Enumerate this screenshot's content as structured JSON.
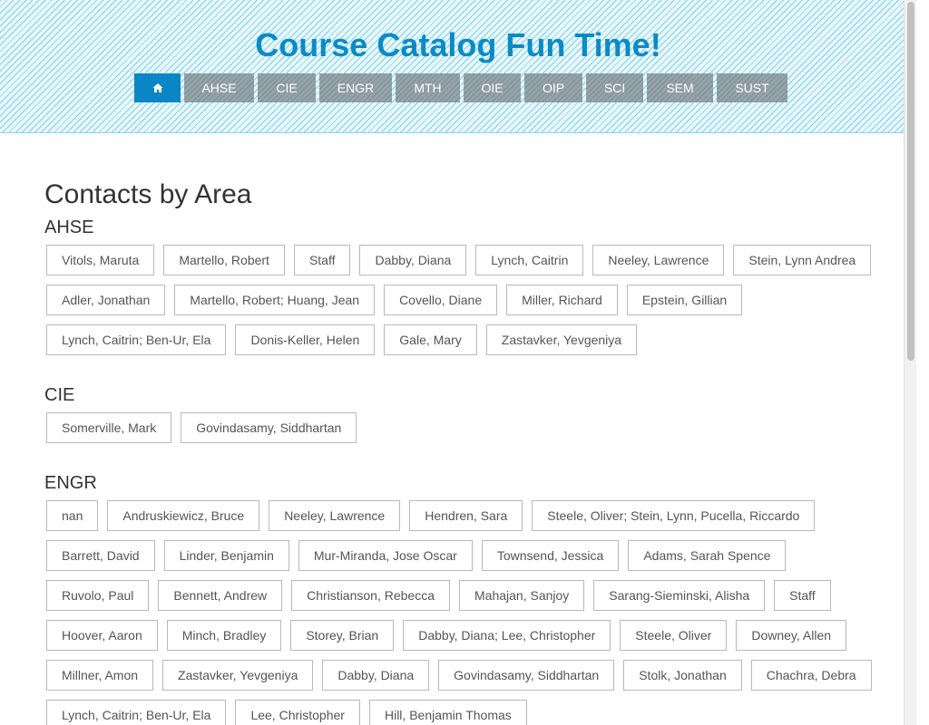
{
  "header": {
    "title": "Course Catalog Fun Time!",
    "nav": [
      {
        "label": "",
        "icon": "home-icon",
        "active": true
      },
      {
        "label": "AHSE"
      },
      {
        "label": "CIE"
      },
      {
        "label": "ENGR"
      },
      {
        "label": "MTH"
      },
      {
        "label": "OIE"
      },
      {
        "label": "OIP"
      },
      {
        "label": "SCI"
      },
      {
        "label": "SEM"
      },
      {
        "label": "SUST"
      }
    ]
  },
  "main": {
    "title": "Contacts by Area",
    "areas": [
      {
        "name": "AHSE",
        "contacts": [
          "Vitols, Maruta",
          "Martello, Robert",
          "Staff",
          "Dabby, Diana",
          "Lynch, Caitrin",
          "Neeley, Lawrence",
          "Stein, Lynn Andrea",
          "Adler, Jonathan",
          "Martello, Robert; Huang, Jean",
          "Covello, Diane",
          "Miller, Richard",
          "Epstein, Gillian",
          "Lynch, Caitrin; Ben-Ur, Ela",
          "Donis-Keller, Helen",
          "Gale, Mary",
          "Zastavker, Yevgeniya"
        ]
      },
      {
        "name": "CIE",
        "contacts": [
          "Somerville, Mark",
          "Govindasamy, Siddhartan"
        ]
      },
      {
        "name": "ENGR",
        "contacts": [
          "nan",
          "Andruskiewicz, Bruce",
          "Neeley, Lawrence",
          "Hendren, Sara",
          "Steele, Oliver; Stein, Lynn, Pucella, Riccardo",
          "Barrett, David",
          "Linder, Benjamin",
          "Mur-Miranda, Jose Oscar",
          "Townsend, Jessica",
          "Adams, Sarah Spence",
          "Ruvolo, Paul",
          "Bennett, Andrew",
          "Christianson, Rebecca",
          "Mahajan, Sanjoy",
          "Sarang-Sieminski, Alisha",
          "Staff",
          "Hoover, Aaron",
          "Minch, Bradley",
          "Storey, Brian",
          "Dabby, Diana; Lee, Christopher",
          "Steele, Oliver",
          "Downey, Allen",
          "Millner, Amon",
          "Zastavker, Yevgeniya",
          "Dabby, Diana",
          "Govindasamy, Siddhartan",
          "Stolk, Jonathan",
          "Chachra, Debra",
          "Lynch, Caitrin; Ben-Ur, Ela",
          "Lee, Christopher",
          "Hill, Benjamin Thomas"
        ]
      }
    ]
  },
  "colors": {
    "title": "#0a8bc7",
    "nav_active": "#0a86c6",
    "nav_inactive": "#8d9ba3"
  }
}
